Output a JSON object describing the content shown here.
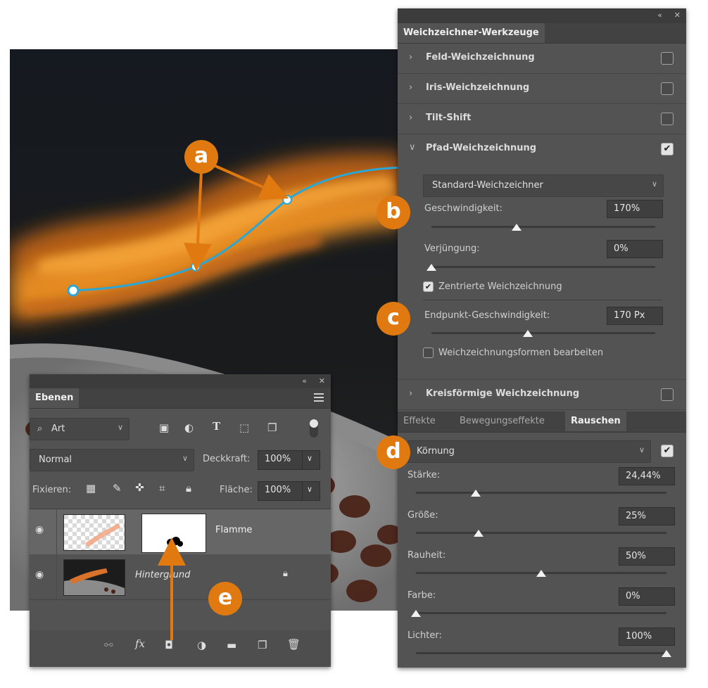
{
  "blur_panel": {
    "window_controls": {
      "collapse": "«",
      "close": "✕"
    },
    "tab": "Weichzeichner-Werkzeuge",
    "sections": [
      {
        "label": "Feld-Weichzeichnung",
        "checked": false
      },
      {
        "label": "Iris-Weichzeichnung",
        "checked": false
      },
      {
        "label": "Tilt-Shift",
        "checked": false
      },
      {
        "label": "Pfad-Weichzeichnung",
        "checked": true
      }
    ],
    "path_blur": {
      "mode": "Standard-Weichzeichner",
      "speed": {
        "label": "Geschwindigkeit:",
        "value": "170%",
        "slider": 0.38
      },
      "taper": {
        "label": "Verjüngung:",
        "value": "0%",
        "slider": 0.0
      },
      "centered_label": "Zentrierte Weichzeichnung",
      "centered_checked": true,
      "endpoint": {
        "label": "Endpunkt-Geschwindigkeit:",
        "value": "170 Px",
        "slider": 0.43
      },
      "edit_shapes_label": "Weichzeichnungsformen bearbeiten",
      "edit_shapes_checked": false
    },
    "spin_blur": {
      "label": "Kreisförmige Weichzeichnung",
      "checked": false
    },
    "effect_tabs": [
      "Effekte",
      "Bewegungseffekte",
      "Rauschen"
    ],
    "active_effect_tab": "Rauschen",
    "noise": {
      "type": "Körnung",
      "enabled": true,
      "amount": {
        "label": "Stärke:",
        "value": "24,44%",
        "slider": 0.24
      },
      "size": {
        "label": "Größe:",
        "value": "25%",
        "slider": 0.25
      },
      "roughness": {
        "label": "Rauheit:",
        "value": "50%",
        "slider": 0.5
      },
      "color": {
        "label": "Farbe:",
        "value": "0%",
        "slider": 0.0
      },
      "highlights": {
        "label": "Lichter:",
        "value": "100%",
        "slider": 1.0
      }
    }
  },
  "layers_panel": {
    "window_controls": {
      "collapse": "«",
      "close": "✕"
    },
    "tab": "Ebenen",
    "menu_icon": "hamburger-icon",
    "filter_kind": "Art",
    "blend_mode": "Normal",
    "opacity_label": "Deckkraft:",
    "opacity_value": "100%",
    "lock_label": "Fixieren:",
    "fill_label": "Fläche:",
    "fill_value": "100%",
    "layers": [
      {
        "name": "Flamme",
        "visible": true,
        "selected": true,
        "locked": false
      },
      {
        "name": "Hintergrund",
        "visible": true,
        "selected": false,
        "locked": true
      }
    ],
    "bottom_fx": "fx"
  },
  "callouts": [
    "a",
    "b",
    "c",
    "d",
    "e"
  ],
  "colors": {
    "panel_bg": "#535353",
    "callout_orange": "#e07a10",
    "path_blue": "#2aa7d6"
  }
}
